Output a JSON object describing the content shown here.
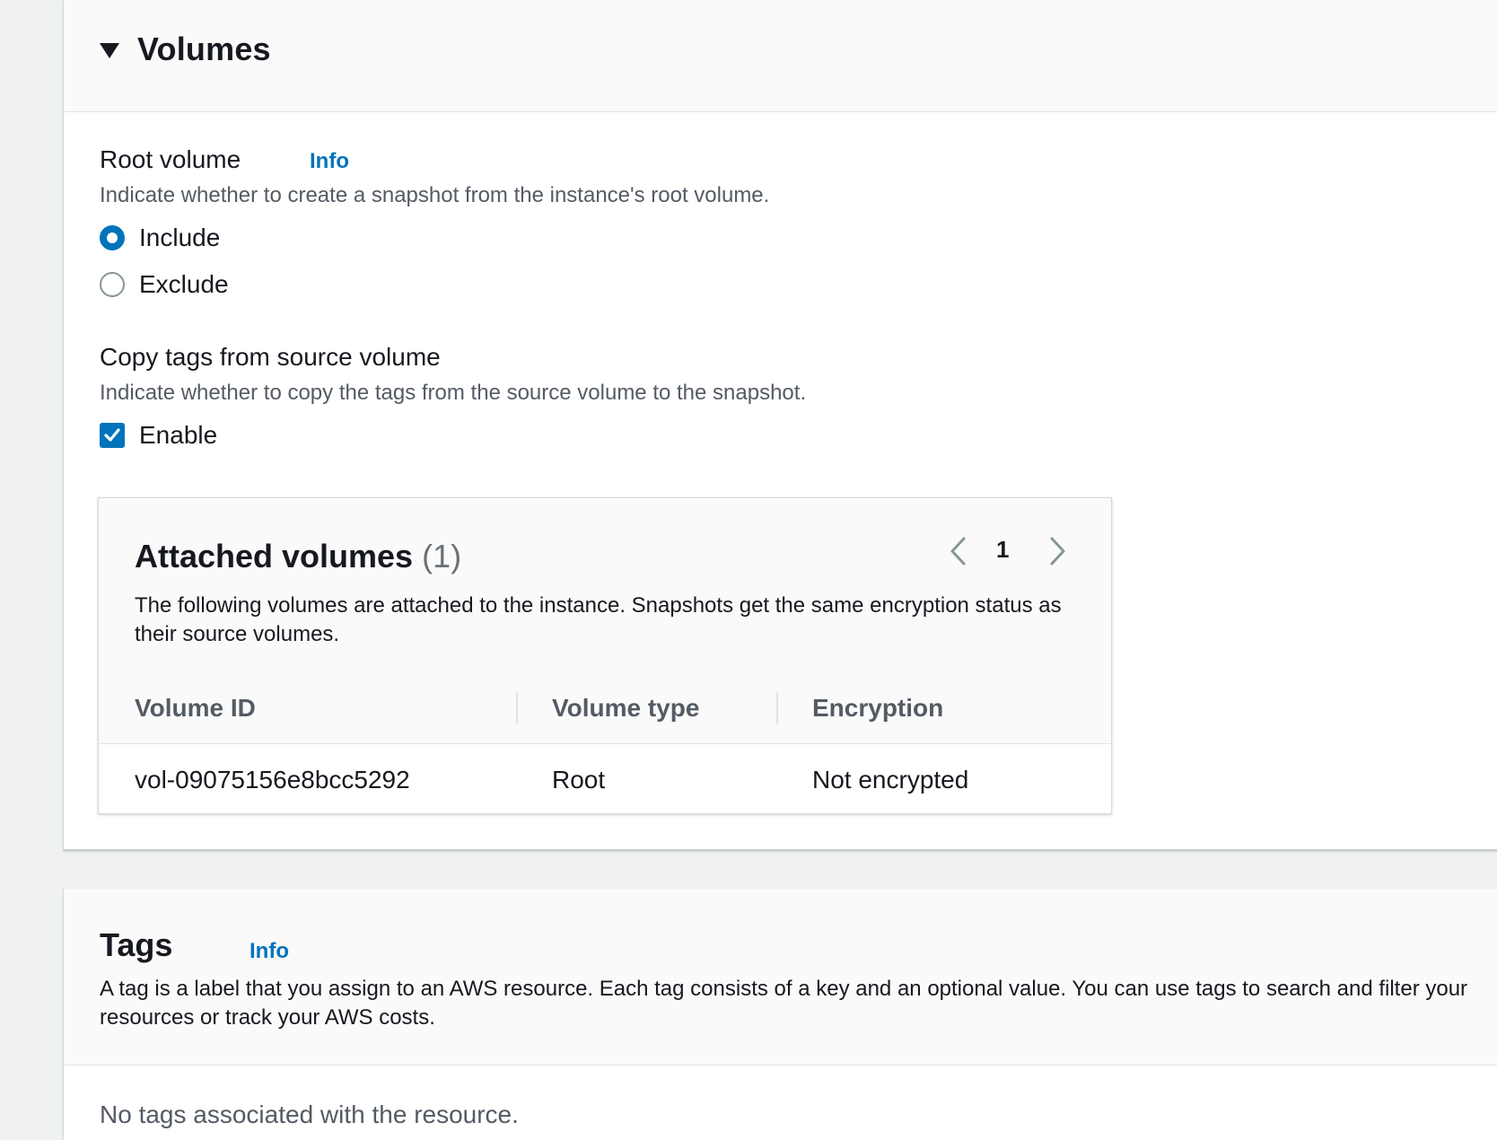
{
  "volumes_panel": {
    "title": "Volumes",
    "root_volume": {
      "label": "Root volume",
      "info_link": "Info",
      "description": "Indicate whether to create a snapshot from the instance's root volume.",
      "options": [
        {
          "label": "Include",
          "selected": true
        },
        {
          "label": "Exclude",
          "selected": false
        }
      ]
    },
    "copy_tags": {
      "label": "Copy tags from source volume",
      "description": "Indicate whether to copy the tags from the source volume to the snapshot.",
      "checkbox_label": "Enable",
      "checked": true
    },
    "attached_volumes": {
      "title": "Attached volumes",
      "count": "(1)",
      "description": "The following volumes are attached to the instance. Snapshots get the same encryption status as their source volumes.",
      "pagination": {
        "current_page": "1"
      },
      "columns": [
        "Volume ID",
        "Volume type",
        "Encryption"
      ],
      "rows": [
        [
          "vol-09075156e8bcc5292",
          "Root",
          "Not encrypted"
        ]
      ]
    }
  },
  "tags_panel": {
    "title": "Tags",
    "info_link": "Info",
    "description": "A tag is a label that you assign to an AWS resource. Each tag consists of a key and an optional value. You can use tags to search and filter your resources or track your AWS costs.",
    "empty_message": "No tags associated with the resource."
  },
  "colors": {
    "accent": "#0073bb",
    "page_background": "#f0f1f1",
    "header_background": "#fafafa"
  },
  "icons": {
    "collapse": "caret-down-icon",
    "prev_page": "chevron-left-icon",
    "next_page": "chevron-right-icon",
    "check": "checkmark-icon"
  }
}
